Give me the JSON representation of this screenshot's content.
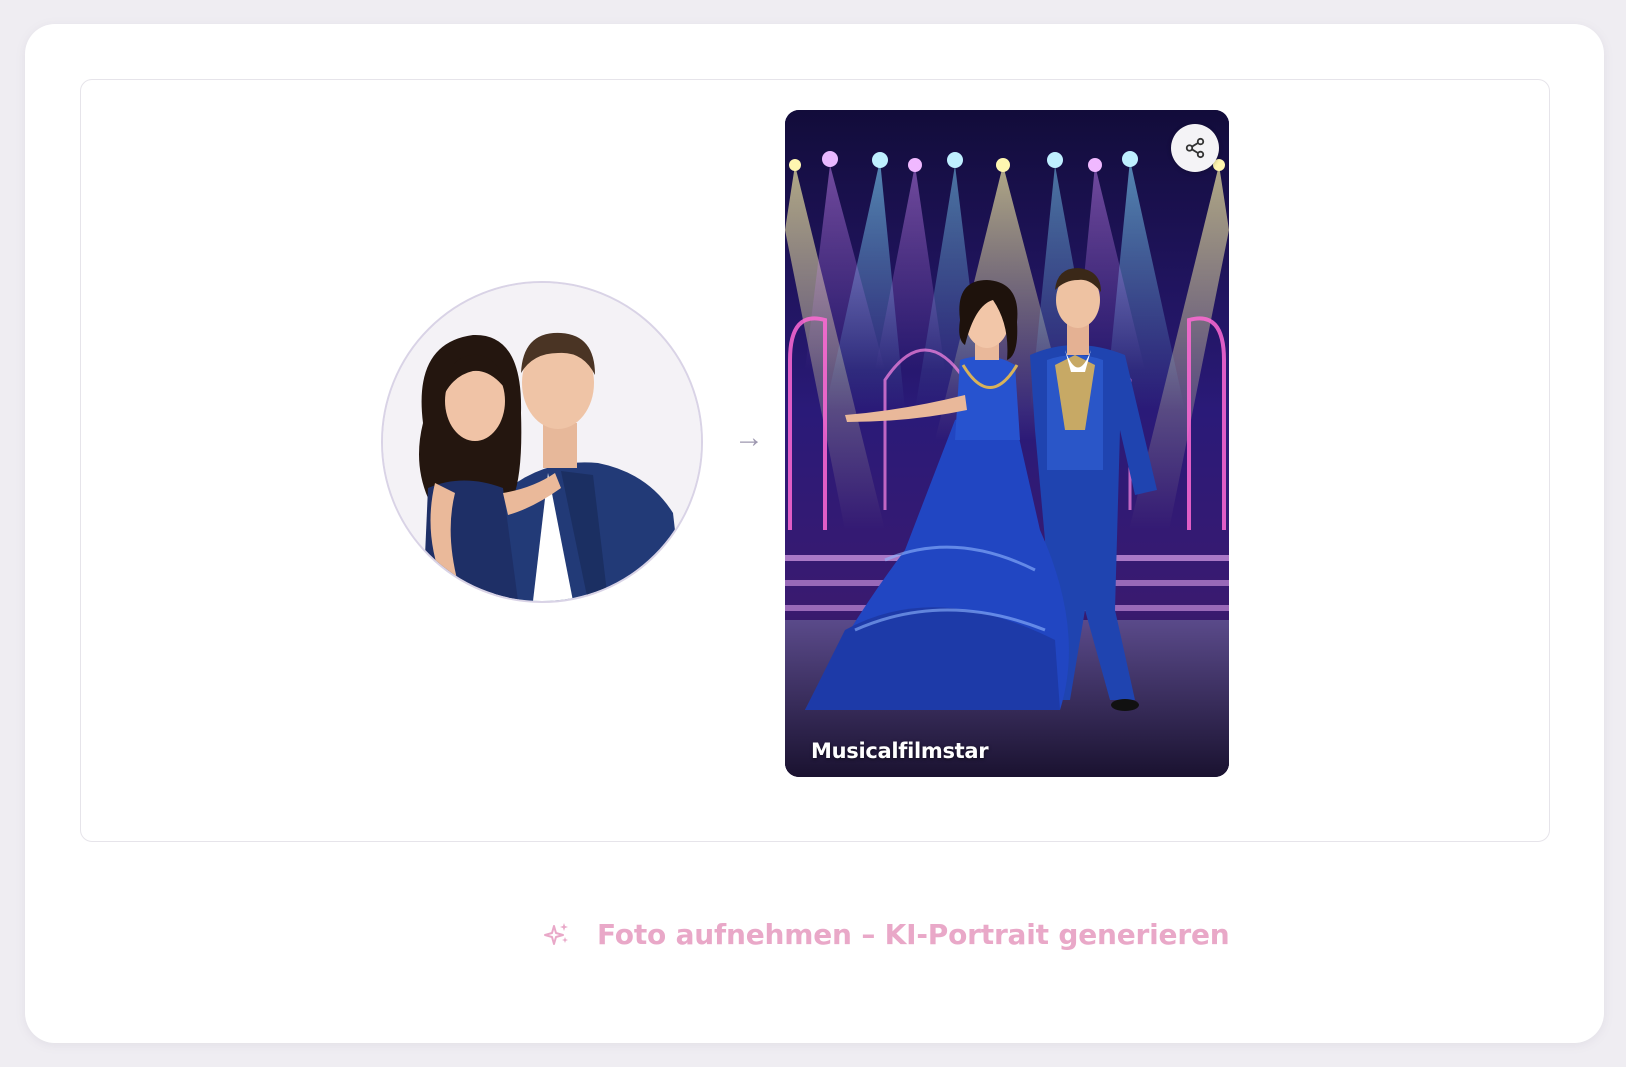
{
  "result": {
    "style_label": "Musicalfilmstar",
    "share_icon": "share-icon"
  },
  "transition": {
    "arrow_glyph": "→"
  },
  "cta": {
    "icon": "sparkles-icon",
    "label": "Foto aufnehmen – KI-Portrait generieren",
    "color": "#e9a8c8"
  },
  "colors": {
    "page_background": "#efedf2",
    "card_background": "#ffffff",
    "panel_border": "#e6e4ea",
    "stage_background": "#1b1450"
  }
}
